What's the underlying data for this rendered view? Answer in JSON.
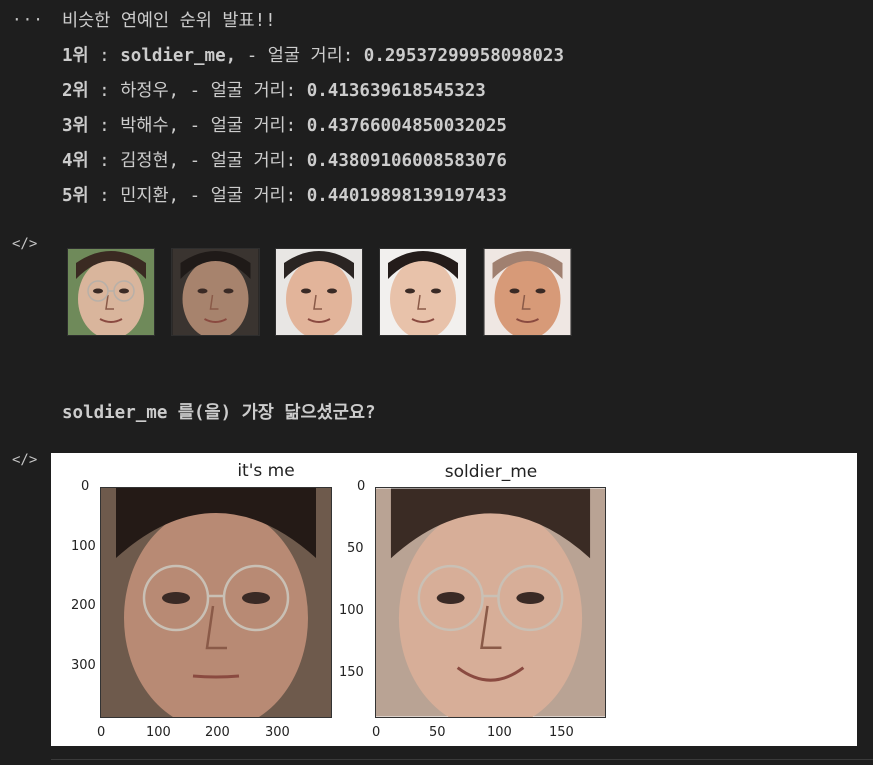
{
  "gutter": {
    "ellipsis": "···",
    "code_icon": "</>"
  },
  "output": {
    "heading": "비슷한 연예인 순위 발표!!",
    "rankings": [
      {
        "rank": "1위",
        "name": "soldier_me,",
        "label": "- 얼굴 거리:",
        "distance": "0.29537299958098023"
      },
      {
        "rank": "2위",
        "name": "하정우,",
        "label": "- 얼굴 거리:",
        "distance": "0.413639618545323"
      },
      {
        "rank": "3위",
        "name": "박해수,",
        "label": "- 얼굴 거리:",
        "distance": "0.43766004850032025"
      },
      {
        "rank": "4위",
        "name": "김정현,",
        "label": "- 얼굴 거리:",
        "distance": "0.43809106008583076"
      },
      {
        "rank": "5위",
        "name": "민지환,",
        "label": "- 얼굴 거리:",
        "distance": "0.44019898139197433"
      }
    ],
    "separator": " : ",
    "conclusion": "soldier_me 를(을) 가장 닮으셨군요?"
  },
  "faces": [
    {
      "name": "soldier_me",
      "skin": "#d9b59c",
      "hair": "#3a2a22",
      "bg": "#6f8a5a",
      "glasses": true
    },
    {
      "name": "하정우",
      "skin": "#a7836d",
      "hair": "#1f1a18",
      "bg": "#3a3430",
      "glasses": false
    },
    {
      "name": "박해수",
      "skin": "#e2b49a",
      "hair": "#2a2422",
      "bg": "#e8e6e4",
      "glasses": false
    },
    {
      "name": "김정현",
      "skin": "#e8c2aa",
      "hair": "#241c1a",
      "bg": "#f2f0ee",
      "glasses": false
    },
    {
      "name": "민지환",
      "skin": "#d79a78",
      "hair": "#a08070",
      "bg": "#efe7e3",
      "glasses": false
    }
  ],
  "plots": [
    {
      "title": "it's me",
      "yticks": [
        "0",
        "100",
        "200",
        "300"
      ],
      "xticks": [
        "0",
        "100",
        "200",
        "300"
      ]
    },
    {
      "title": "soldier_me",
      "yticks": [
        "0",
        "50",
        "100",
        "150"
      ],
      "xticks": [
        "0",
        "50",
        "100",
        "150"
      ]
    }
  ]
}
